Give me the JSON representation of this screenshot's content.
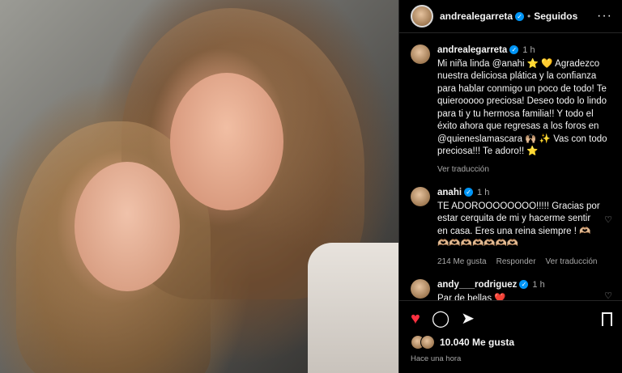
{
  "post": {
    "author": "andrealegarreta",
    "follow_status": "Seguidos",
    "more_icon": "more-horizontal-icon"
  },
  "caption": {
    "username": "andrealegarreta",
    "time": "1 h",
    "text": "Mi niña linda @anahi ⭐ 💛 Agradezco nuestra deliciosa plática y la confianza para hablar conmigo un poco de todo! Te quierooooo preciosa! Deseo todo lo lindo para ti y tu hermosa familia!! Y todo el éxito ahora que regresas a los foros en @quieneslamascara 🙌🏼 ✨ Vas con todo preciosa!!! Te adoro!! ⭐",
    "translate": "Ver traducción"
  },
  "comments": [
    {
      "username": "anahi",
      "time": "1 h",
      "text": "TE ADOROOOOOOOO!!!!! Gracias por estar cerquita de mi y hacerme sentir en casa. Eres una reina siempre ! 🫶🏼 🫶🏼🫶🏼🫶🏼🫶🏼🫶🏼🫶🏼🫶🏼",
      "likes": "214 Me gusta",
      "reply": "Responder",
      "translate": "Ver traducción"
    },
    {
      "username": "andy___rodriguez",
      "time": "1 h",
      "text": "Par de bellas ❤️"
    }
  ],
  "footer": {
    "likes": "10.040 Me gusta",
    "posted": "Hace una hora"
  }
}
